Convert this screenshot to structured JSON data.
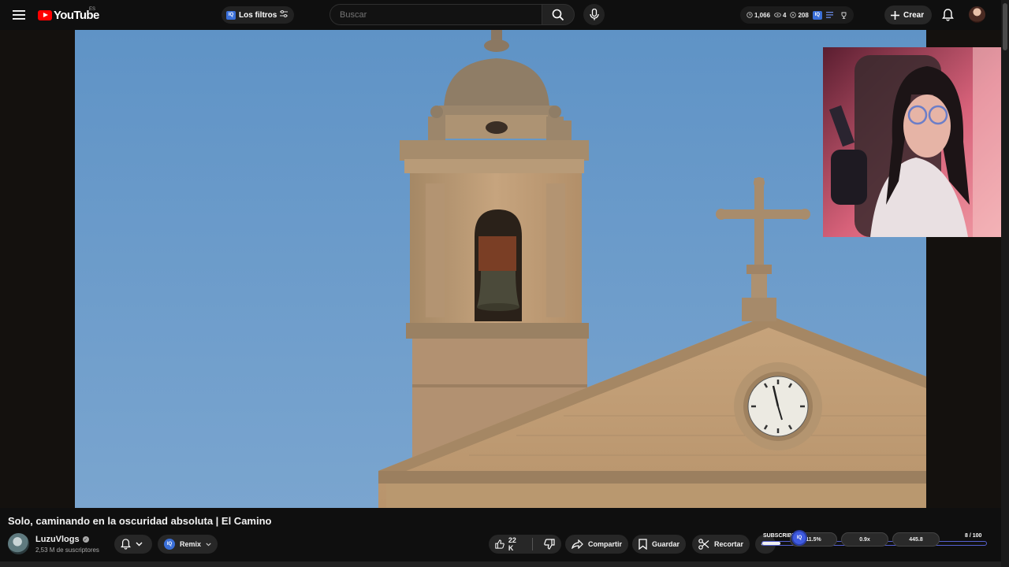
{
  "topbar": {
    "logo_text": "YouTube",
    "country_code": "ES",
    "filters_badge": "IQ",
    "filters_label": "Los filtros",
    "search_placeholder": "Buscar",
    "stats": {
      "views": "1,066",
      "eye_count": "4",
      "comments": "208"
    },
    "create_label": "Crear",
    "icons": [
      "menu-icon",
      "filters-icon",
      "search-icon",
      "mic-icon",
      "clock-icon",
      "eye-icon",
      "comment-icon",
      "list-icon",
      "trophy-icon",
      "plus-icon",
      "bell-icon"
    ]
  },
  "video": {
    "title": "Solo, caminando en la oscuridad absoluta | El Camino"
  },
  "channel": {
    "name": "LuzuVlogs",
    "verified": true,
    "subscribers": "2,53 M de suscriptores"
  },
  "actions": {
    "remix_badge": "IQ",
    "remix_label": "Remix",
    "like_count": "22 K",
    "share_label": "Compartir",
    "save_label": "Guardar",
    "clip_label": "Recortar"
  },
  "subscriber_widget": {
    "label": "SUBSCRIBERS",
    "knob_label": "IQ",
    "chips": [
      "11.5%",
      "0.9x",
      "445.8"
    ],
    "count": "8 / 100",
    "progress": 0.08
  },
  "colors": {
    "background": "#0f0f0f",
    "brand_red": "#ff0000",
    "iq_blue": "#3a6fd8",
    "sky": "#6e9bc8"
  }
}
